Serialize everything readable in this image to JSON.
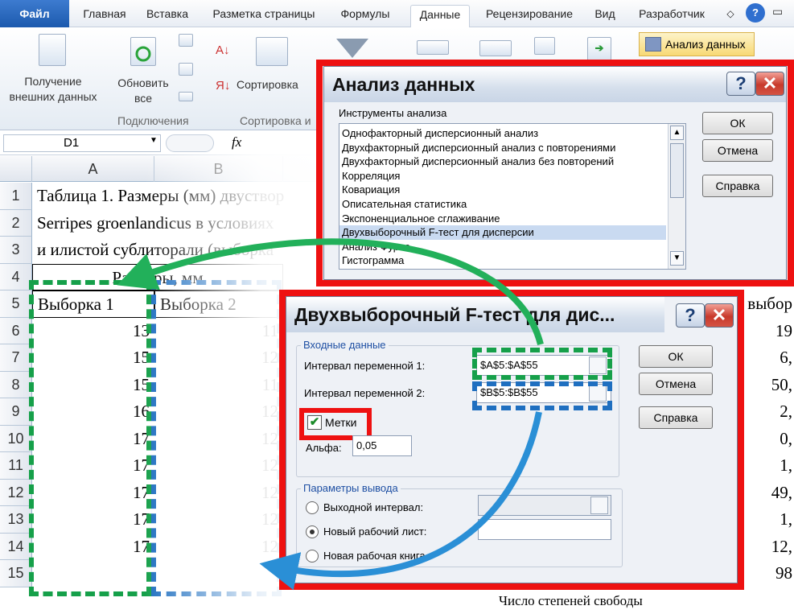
{
  "ribbon": {
    "tabs": [
      "Файл",
      "Главная",
      "Вставка",
      "Разметка страницы",
      "Формулы",
      "Данные",
      "Рецензирование",
      "Вид",
      "Разработчик"
    ],
    "get_external": "Получение\nвнешних данных",
    "refresh_all": "Обновить\nвсе",
    "connections_group": "Подключения",
    "sort_button": "Сортировка",
    "sort_group": "Сортировка и",
    "data_analysis": "Анализ данных",
    "name_box": "D1",
    "fx": "fx"
  },
  "sheet": {
    "columns": [
      "A",
      "B"
    ],
    "rows": [
      "1",
      "2",
      "3",
      "4",
      "5",
      "6",
      "7",
      "8",
      "9",
      "10",
      "11",
      "12",
      "13",
      "14",
      "15"
    ],
    "r1": "Таблица 1. Размеры (мм) двуствор",
    "r2": "Serripes groenlandicus в  условиях",
    "r3": "и илистой сублиторали (выборка",
    "r4": "Размеры, мм",
    "h_a": "Выборка 1",
    "h_b": "Выборка 2",
    "a": [
      "13",
      "15",
      "15",
      "16",
      "17",
      "17",
      "17",
      "17",
      "17"
    ],
    "b": [
      "11",
      "12",
      "11",
      "12",
      "12",
      "12",
      "12",
      "12",
      "12"
    ],
    "right": [
      "выбор",
      "19",
      "6,",
      "50,",
      "2,",
      "0,",
      "1,",
      "49,",
      "1,",
      "12,",
      "98"
    ],
    "bottom_text": "Число степеней свободы"
  },
  "analysis_dialog": {
    "title": "Анализ данных",
    "tools_label": "Инструменты анализа",
    "items": [
      "Однофакторный дисперсионный анализ",
      "Двухфакторный дисперсионный анализ с повторениями",
      "Двухфакторный дисперсионный анализ без повторений",
      "Корреляция",
      "Ковариация",
      "Описательная статистика",
      "Экспоненциальное сглаживание",
      "Двухвыборочный F-тест для дисперсии",
      "Анализ Фурье",
      "Гистограмма"
    ],
    "ok": "ОК",
    "cancel": "Отмена",
    "help": "Справка"
  },
  "ftest_dialog": {
    "title": "Двухвыборочный F-тест для дис...",
    "input_group": "Входные данные",
    "var1_label": "Интервал переменной 1:",
    "var1_value": "$A$5:$A$55",
    "var2_label": "Интервал переменной 2:",
    "var2_value": "$B$5:$B$55",
    "labels_checkbox": "Метки",
    "alpha_label": "Альфа:",
    "alpha_value": "0,05",
    "output_group": "Параметры вывода",
    "out_range": "Выходной интервал:",
    "new_sheet": "Новый рабочий лист:",
    "new_book": "Новая рабочая книга",
    "ok": "ОК",
    "cancel": "Отмена",
    "help": "Справка"
  },
  "colors": {
    "highlight_red": "#ee1111",
    "dash_green": "#16a04a",
    "dash_blue": "#1f6fc0",
    "arrow_green": "#22b05a",
    "arrow_blue": "#2a8fd6"
  }
}
